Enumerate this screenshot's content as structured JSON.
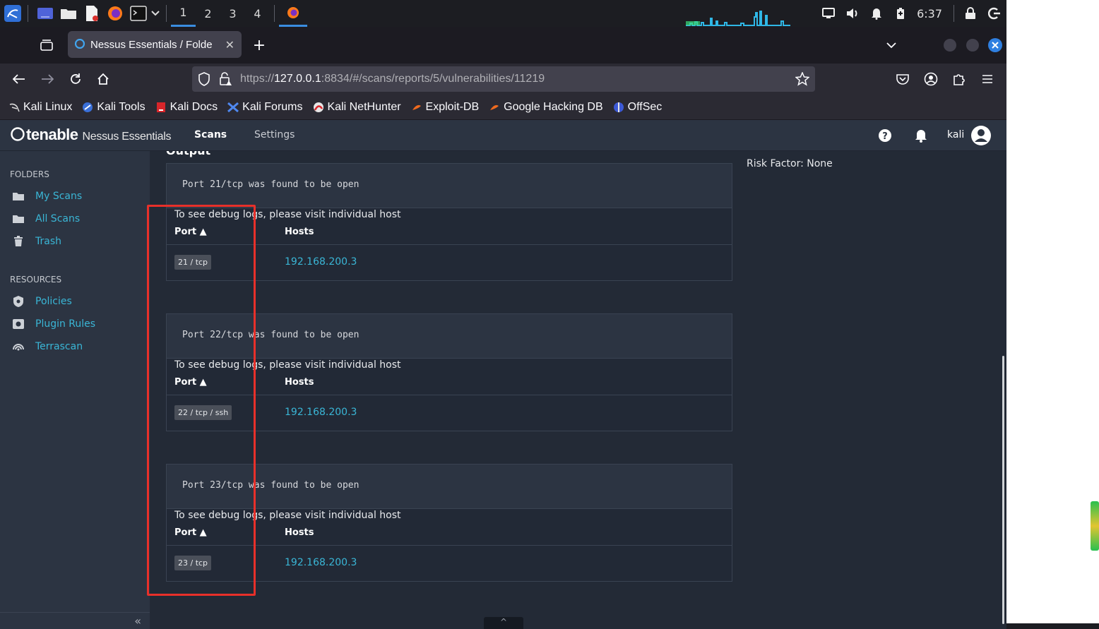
{
  "panel": {
    "workspaces": [
      "1",
      "2",
      "3",
      "4"
    ],
    "active_workspace": "1",
    "clock": "6:37",
    "icons": [
      "kali-menu-icon",
      "desktop-icon",
      "files-icon",
      "text-editor-icon",
      "firefox-icon",
      "terminal-icon"
    ]
  },
  "browser": {
    "tab_title": "Nessus Essentials / Folde",
    "url_prefix": "https://",
    "url_host": "127.0.0.1",
    "url_rest": ":8834/#/scans/reports/5/vulnerabilities/11219",
    "bookmarks": [
      "Kali Linux",
      "Kali Tools",
      "Kali Docs",
      "Kali Forums",
      "Kali NetHunter",
      "Exploit-DB",
      "Google Hacking DB",
      "OffSec"
    ]
  },
  "nessus": {
    "logo_brand": "tenable",
    "logo_product": "Nessus Essentials",
    "nav_scans": "Scans",
    "nav_settings": "Settings",
    "user": "kali"
  },
  "sidebar": {
    "folders_heading": "FOLDERS",
    "folders": [
      {
        "label": "My Scans",
        "icon": "folder-icon"
      },
      {
        "label": "All Scans",
        "icon": "folder-icon"
      },
      {
        "label": "Trash",
        "icon": "trash-icon"
      }
    ],
    "resources_heading": "RESOURCES",
    "resources": [
      {
        "label": "Policies",
        "icon": "shield-icon"
      },
      {
        "label": "Plugin Rules",
        "icon": "plugin-rules-icon"
      },
      {
        "label": "Terrascan",
        "icon": "terrascan-icon"
      }
    ],
    "collapse": "«"
  },
  "main": {
    "output_heading": "Output",
    "risk_factor": "Risk Factor: None",
    "debug_note": "To see debug logs, please visit individual host",
    "col_port": "Port ▲",
    "col_hosts": "Hosts",
    "scroll_top": "^",
    "outputs": [
      {
        "text": "Port 21/tcp was found to be open",
        "port": "21 / tcp",
        "host": "192.168.200.3"
      },
      {
        "text": "Port 22/tcp was found to be open",
        "port": "22 / tcp / ssh",
        "host": "192.168.200.3"
      },
      {
        "text": "Port 23/tcp was found to be open",
        "port": "23 / tcp",
        "host": "192.168.200.3"
      }
    ]
  },
  "colors": {
    "accent_link": "#3ab6d6",
    "header_bg": "#2c3442",
    "content_bg": "#232a36",
    "highlight_box": "#e8302a"
  }
}
